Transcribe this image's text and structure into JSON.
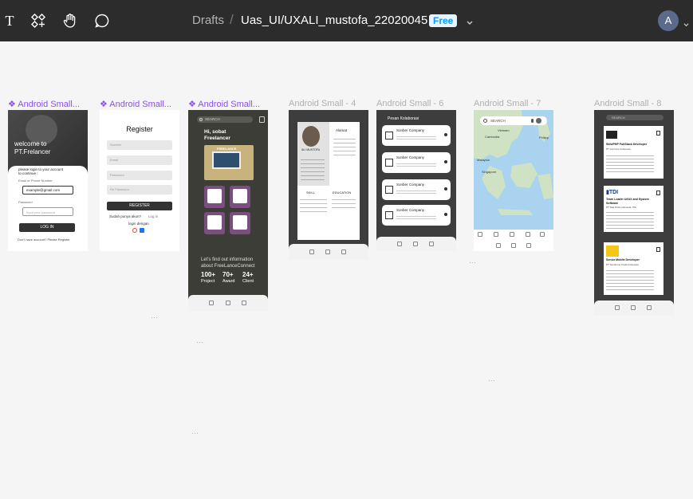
{
  "toolbar": {
    "text_tool": "T",
    "crumb_root": "Drafts",
    "separator": "/",
    "file_name": "Uas_UI/UXALI_mustofa_22020045",
    "plan_badge": "Free",
    "avatar_initial": "A"
  },
  "frames": {
    "f1": {
      "label": "❖ Android Small...",
      "hero": "welcome to\nPT.Frelancer",
      "prompt": "please login to your account\nto continue :",
      "email_label": "Email or Phone Number",
      "email_value": "example@gmail.com",
      "password_label": "Password",
      "password_placeholder": "Input your password",
      "login_button": "LOG IN",
      "register_hint": "Don't have account? Please Register"
    },
    "f2": {
      "label": "❖ Android Small...",
      "title": "Register",
      "fields": [
        "Number",
        "Email",
        "Password",
        "Re Password"
      ],
      "register_button": "REGISTER",
      "have_account": "Sudah punya akun?",
      "login_link": "Log in",
      "login_with": "login dengan"
    },
    "f3": {
      "label": "❖ Android Small...",
      "search": "SEARCH",
      "greeting": "Hi, sobat\nFreelancer",
      "banner": "FREELANCE",
      "info": "Let's find out information\nabout FreeLanceConnect",
      "stats": [
        {
          "value": "100+",
          "label": "Project"
        },
        {
          "value": "70+",
          "label": "Award"
        },
        {
          "value": "24+",
          "label": "Client"
        }
      ]
    },
    "f4": {
      "label": "Android Small - 4",
      "alamat": "Alamat",
      "name": "ALI MUSTOFA",
      "skill": "SKILL",
      "education": "EDUCATION"
    },
    "f6": {
      "label": "Android Small - 6",
      "title": "Pesan Kolaborasi",
      "items": [
        "Sonber Company",
        "Sonber Company",
        "Sonber Company",
        "Sonber Company"
      ]
    },
    "f7": {
      "label": "Android Small - 7",
      "search": "SEARCH",
      "places": [
        "Vietnam",
        "Cambodia",
        "Philipp",
        "Malaysia",
        "Singapore"
      ]
    },
    "f8": {
      "label": "Android Small - 8",
      "search": "SEARCH",
      "jobs": [
        {
          "title": "Web/PHP FullStack Developer",
          "company": "PT Grit Core Indonesia"
        },
        {
          "title": "Team Leader UI/UX and System Software",
          "company": "PT Tata Dirta Indonesia, Tbk"
        },
        {
          "title": "Senior Mobile Developer",
          "company": "PT Sumitomo Kredit Indonesia"
        }
      ]
    }
  }
}
